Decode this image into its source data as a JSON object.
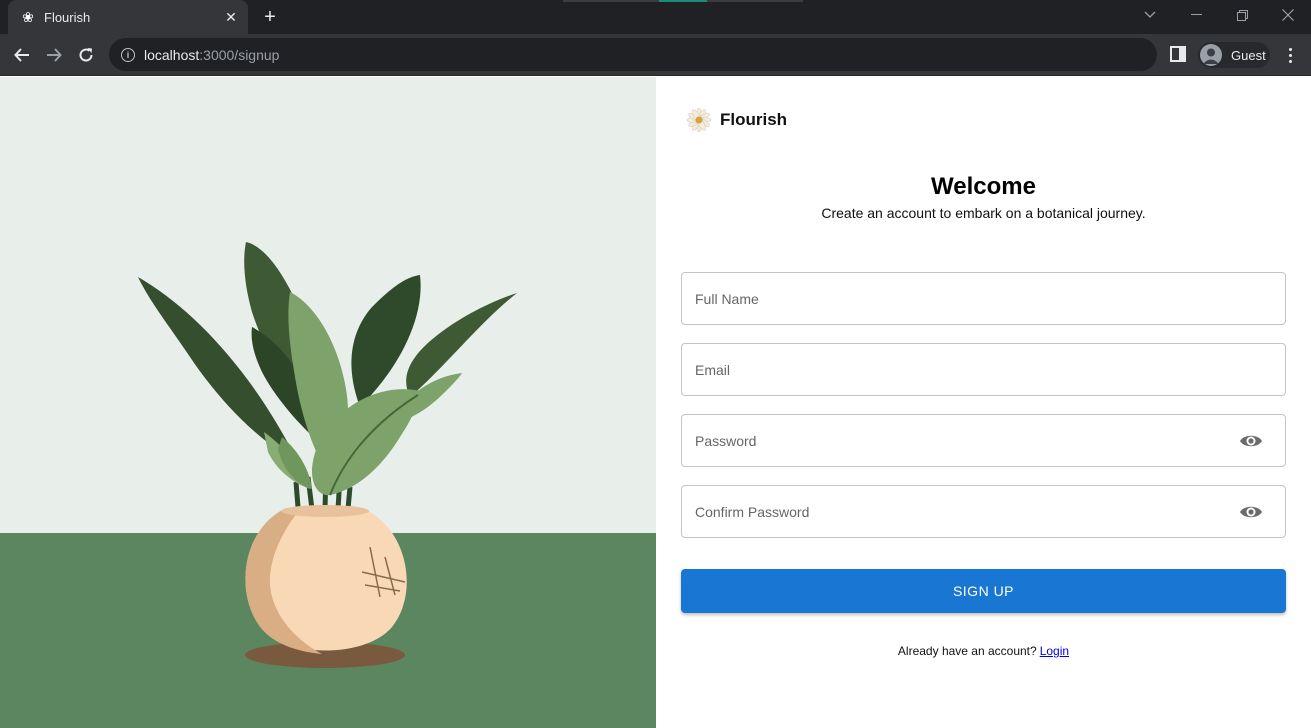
{
  "browser": {
    "tab_title": "Flourish",
    "tab_close": "✕",
    "new_tab": "+",
    "url_host": "localhost",
    "url_path": ":3000/signup",
    "profile_label": "Guest"
  },
  "brand": {
    "name": "Flourish"
  },
  "form": {
    "heading": "Welcome",
    "subheading": "Create an account to embark on a botanical journey.",
    "full_name_placeholder": "Full Name",
    "email_placeholder": "Email",
    "password_placeholder": "Password",
    "confirm_password_placeholder": "Confirm Password",
    "submit_label": "SIGN UP",
    "account_prompt": "Already have an account?",
    "login_link": "Login"
  },
  "colors": {
    "primary_button": "#1976d2",
    "hero_wall": "#e8efeb",
    "hero_floor": "#5b8660"
  }
}
